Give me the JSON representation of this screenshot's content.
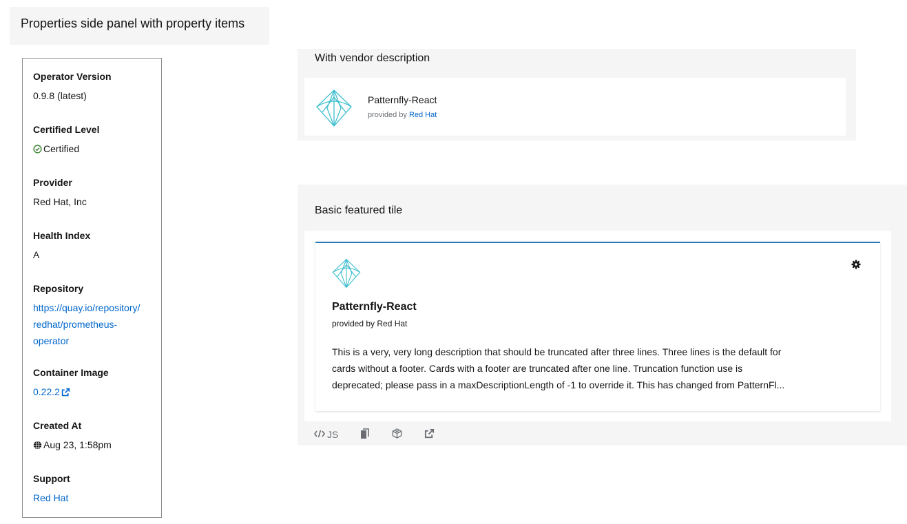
{
  "left_panel": {
    "title": "Properties side panel with property items",
    "properties": [
      {
        "label": "Operator Version",
        "value": "0.9.8 (latest)"
      },
      {
        "label": "Certified Level",
        "value": "Certified",
        "icon": "check-circle-icon"
      },
      {
        "label": "Provider",
        "value": "Red Hat, Inc"
      },
      {
        "label": "Health Index",
        "value": "A"
      },
      {
        "label": "Repository",
        "value_lines": [
          "https://quay.io/repository/",
          "redhat/prometheus-",
          "operator"
        ]
      },
      {
        "label": "Container Image",
        "value": "0.22.2",
        "icon": "external-link-icon"
      },
      {
        "label": "Created At",
        "value": "Aug 23, 1:58pm",
        "icon": "globe-icon"
      },
      {
        "label": "Support",
        "value": "Red Hat"
      }
    ]
  },
  "vendor_section": {
    "title": "With vendor description",
    "tile": {
      "name": "Patternfly-React",
      "provided_by_prefix": "provided by ",
      "vendor": "Red Hat",
      "logo_icon": "patternfly-logo-icon"
    }
  },
  "featured_section": {
    "title": "Basic featured tile",
    "tile": {
      "name": "Patternfly-React",
      "provided_by": "provided by Red Hat",
      "description_lines": [
        "This is a very, very long description that should be truncated after three lines. Three lines is the default for",
        "cards without a footer. Cards with a footer are truncated after one line. Truncation function use is",
        "deprecated; please pass in a maxDescriptionLength of -1 to override it. This has changed from PatternFl..."
      ],
      "badge_icon": "gear-icon",
      "accent_color": "#2b7ab8"
    },
    "toolbar": {
      "js_label": "JS",
      "icons": [
        "code-icon",
        "copy-icon",
        "codesandbox-icon",
        "external-link-icon"
      ]
    }
  },
  "colors": {
    "link": "#0066cc",
    "section_bg": "#f5f5f5",
    "logo_cyan": "#3fbfcf"
  }
}
